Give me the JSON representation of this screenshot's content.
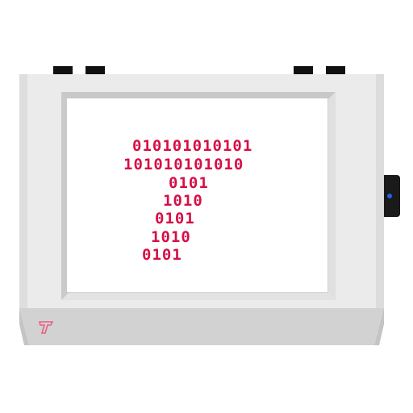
{
  "device": {
    "body_color": "#ececec",
    "bezel_color": "#d3d3d3",
    "accent_color": "#d60f45",
    "led_color": "#1e63e6",
    "logo": "stylized-T-logo"
  },
  "screen": {
    "lines": [
      "010101010101",
      "101010101010",
      "0101",
      "1010",
      "0101",
      "1010",
      "0101"
    ]
  }
}
